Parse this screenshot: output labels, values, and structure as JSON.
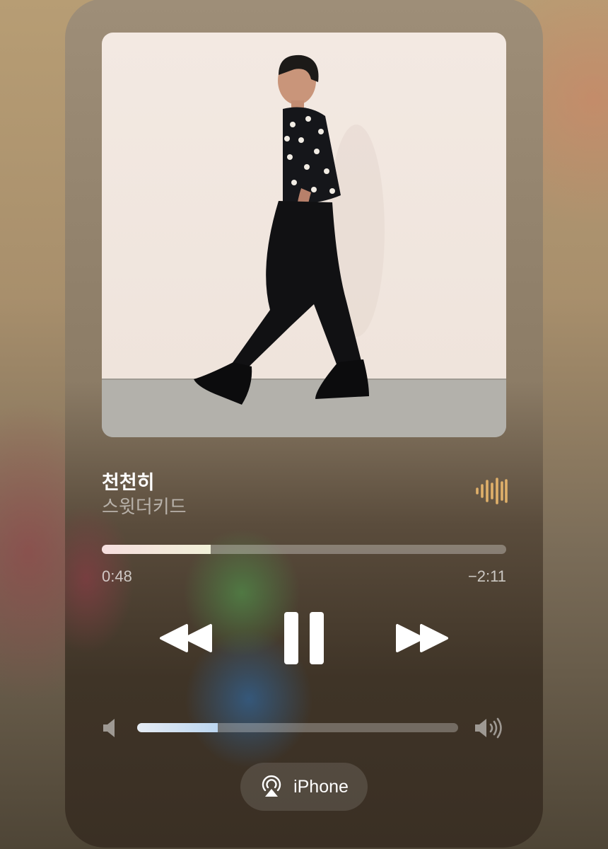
{
  "now_playing": {
    "title": "천천히",
    "artist": "스윗더키드",
    "artwork_icon": "album-art-walking-man",
    "playing_indicator_icon": "audio-wave-icon",
    "accent_color": "#e0b06a"
  },
  "progress": {
    "elapsed": "0:48",
    "remaining": "−2:11",
    "fraction": 0.27
  },
  "controls": {
    "rewind_icon": "rewind-icon",
    "pause_icon": "pause-icon",
    "forward_icon": "fast-forward-icon"
  },
  "volume": {
    "low_icon": "speaker-low-icon",
    "high_icon": "speaker-high-icon",
    "fraction": 0.25
  },
  "output": {
    "device_label": "iPhone",
    "icon": "airplay-icon"
  }
}
